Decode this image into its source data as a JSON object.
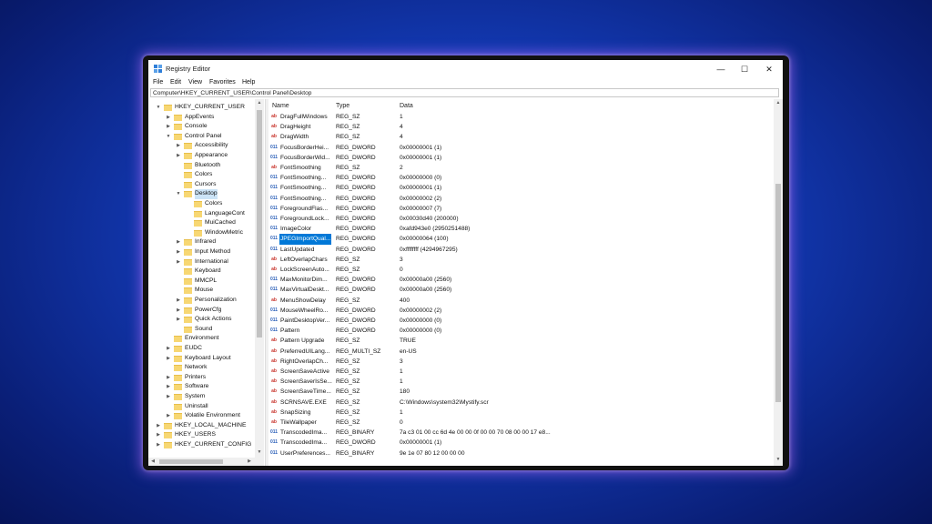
{
  "window": {
    "title": "Registry Editor",
    "controls": {
      "minimize": "—",
      "maximize": "☐",
      "close": "✕"
    }
  },
  "menu": [
    "File",
    "Edit",
    "View",
    "Favorites",
    "Help"
  ],
  "address": "Computer\\HKEY_CURRENT_USER\\Control Panel\\Desktop",
  "tree": [
    {
      "label": "HKEY_CURRENT_USER",
      "level": 0,
      "expander": "open"
    },
    {
      "label": "AppEvents",
      "level": 1,
      "expander": "closed"
    },
    {
      "label": "Console",
      "level": 1,
      "expander": "closed"
    },
    {
      "label": "Control Panel",
      "level": 1,
      "expander": "open"
    },
    {
      "label": "Accessibility",
      "level": 2,
      "expander": "closed"
    },
    {
      "label": "Appearance",
      "level": 2,
      "expander": "closed"
    },
    {
      "label": "Bluetooth",
      "level": 2,
      "expander": "none"
    },
    {
      "label": "Colors",
      "level": 2,
      "expander": "none"
    },
    {
      "label": "Cursors",
      "level": 2,
      "expander": "none"
    },
    {
      "label": "Desktop",
      "level": 2,
      "expander": "open",
      "selected": true
    },
    {
      "label": "Colors",
      "level": 3,
      "expander": "none"
    },
    {
      "label": "LanguageCont",
      "level": 3,
      "expander": "none"
    },
    {
      "label": "MuiCached",
      "level": 3,
      "expander": "none"
    },
    {
      "label": "WindowMetric",
      "level": 3,
      "expander": "none"
    },
    {
      "label": "Infrared",
      "level": 2,
      "expander": "closed"
    },
    {
      "label": "Input Method",
      "level": 2,
      "expander": "closed"
    },
    {
      "label": "International",
      "level": 2,
      "expander": "closed"
    },
    {
      "label": "Keyboard",
      "level": 2,
      "expander": "none"
    },
    {
      "label": "MMCPL",
      "level": 2,
      "expander": "none"
    },
    {
      "label": "Mouse",
      "level": 2,
      "expander": "none"
    },
    {
      "label": "Personalization",
      "level": 2,
      "expander": "closed"
    },
    {
      "label": "PowerCfg",
      "level": 2,
      "expander": "closed"
    },
    {
      "label": "Quick Actions",
      "level": 2,
      "expander": "closed"
    },
    {
      "label": "Sound",
      "level": 2,
      "expander": "none"
    },
    {
      "label": "Environment",
      "level": 1,
      "expander": "none"
    },
    {
      "label": "EUDC",
      "level": 1,
      "expander": "closed"
    },
    {
      "label": "Keyboard Layout",
      "level": 1,
      "expander": "closed"
    },
    {
      "label": "Network",
      "level": 1,
      "expander": "none"
    },
    {
      "label": "Printers",
      "level": 1,
      "expander": "closed"
    },
    {
      "label": "Software",
      "level": 1,
      "expander": "closed"
    },
    {
      "label": "System",
      "level": 1,
      "expander": "closed"
    },
    {
      "label": "Uninstall",
      "level": 1,
      "expander": "none"
    },
    {
      "label": "Volatile Environment",
      "level": 1,
      "expander": "closed"
    },
    {
      "label": "HKEY_LOCAL_MACHINE",
      "level": 0,
      "expander": "closed"
    },
    {
      "label": "HKEY_USERS",
      "level": 0,
      "expander": "closed"
    },
    {
      "label": "HKEY_CURRENT_CONFIG",
      "level": 0,
      "expander": "closed"
    }
  ],
  "columns": {
    "name": "Name",
    "type": "Type",
    "data": "Data"
  },
  "values": [
    {
      "icon": "ab",
      "name": "DragFullWindows",
      "type": "REG_SZ",
      "data": "1"
    },
    {
      "icon": "ab",
      "name": "DragHeight",
      "type": "REG_SZ",
      "data": "4"
    },
    {
      "icon": "ab",
      "name": "DragWidth",
      "type": "REG_SZ",
      "data": "4"
    },
    {
      "icon": "011",
      "name": "FocusBorderHei...",
      "type": "REG_DWORD",
      "data": "0x00000001 (1)"
    },
    {
      "icon": "011",
      "name": "FocusBorderWid...",
      "type": "REG_DWORD",
      "data": "0x00000001 (1)"
    },
    {
      "icon": "ab",
      "name": "FontSmoothing",
      "type": "REG_SZ",
      "data": "2"
    },
    {
      "icon": "011",
      "name": "FontSmoothing...",
      "type": "REG_DWORD",
      "data": "0x00000000 (0)"
    },
    {
      "icon": "011",
      "name": "FontSmoothing...",
      "type": "REG_DWORD",
      "data": "0x00000001 (1)"
    },
    {
      "icon": "011",
      "name": "FontSmoothing...",
      "type": "REG_DWORD",
      "data": "0x00000002 (2)"
    },
    {
      "icon": "011",
      "name": "ForegroundFlas...",
      "type": "REG_DWORD",
      "data": "0x00000007 (7)"
    },
    {
      "icon": "011",
      "name": "ForegroundLock...",
      "type": "REG_DWORD",
      "data": "0x00030d40 (200000)"
    },
    {
      "icon": "011",
      "name": "ImageColor",
      "type": "REG_DWORD",
      "data": "0xafd943e0 (2950251488)"
    },
    {
      "icon": "011",
      "name": "JPEGImportQual...",
      "type": "REG_DWORD",
      "data": "0x00000064 (100)",
      "selected": true
    },
    {
      "icon": "011",
      "name": "LastUpdated",
      "type": "REG_DWORD",
      "data": "0xffffffff (4294967295)"
    },
    {
      "icon": "ab",
      "name": "LeftOverlapChars",
      "type": "REG_SZ",
      "data": "3"
    },
    {
      "icon": "ab",
      "name": "LockScreenAuto...",
      "type": "REG_SZ",
      "data": "0"
    },
    {
      "icon": "011",
      "name": "MaxMonitorDim...",
      "type": "REG_DWORD",
      "data": "0x00000a00 (2560)"
    },
    {
      "icon": "011",
      "name": "MaxVirtualDeskt...",
      "type": "REG_DWORD",
      "data": "0x00000a00 (2560)"
    },
    {
      "icon": "ab",
      "name": "MenuShowDelay",
      "type": "REG_SZ",
      "data": "400"
    },
    {
      "icon": "011",
      "name": "MouseWheelRo...",
      "type": "REG_DWORD",
      "data": "0x00000002 (2)"
    },
    {
      "icon": "011",
      "name": "PaintDesktopVer...",
      "type": "REG_DWORD",
      "data": "0x00000000 (0)"
    },
    {
      "icon": "011",
      "name": "Pattern",
      "type": "REG_DWORD",
      "data": "0x00000000 (0)"
    },
    {
      "icon": "ab",
      "name": "Pattern Upgrade",
      "type": "REG_SZ",
      "data": "TRUE"
    },
    {
      "icon": "ab",
      "name": "PreferredUILang...",
      "type": "REG_MULTI_SZ",
      "data": "en-US"
    },
    {
      "icon": "ab",
      "name": "RightOverlapCh...",
      "type": "REG_SZ",
      "data": "3"
    },
    {
      "icon": "ab",
      "name": "ScreenSaveActive",
      "type": "REG_SZ",
      "data": "1"
    },
    {
      "icon": "ab",
      "name": "ScreenSaverIsSe...",
      "type": "REG_SZ",
      "data": "1"
    },
    {
      "icon": "ab",
      "name": "ScreenSaveTime...",
      "type": "REG_SZ",
      "data": "180"
    },
    {
      "icon": "ab",
      "name": "SCRNSAVE.EXE",
      "type": "REG_SZ",
      "data": "C:\\Windows\\system32\\Mystify.scr"
    },
    {
      "icon": "ab",
      "name": "SnapSizing",
      "type": "REG_SZ",
      "data": "1"
    },
    {
      "icon": "ab",
      "name": "TileWallpaper",
      "type": "REG_SZ",
      "data": "0"
    },
    {
      "icon": "011",
      "name": "TranscodedIma...",
      "type": "REG_BINARY",
      "data": "7a c3 01 00 cc 6d 4e 00 00 0f 00 00 70 08 00 00 17 e8..."
    },
    {
      "icon": "011",
      "name": "TranscodedIma...",
      "type": "REG_DWORD",
      "data": "0x00000001 (1)"
    },
    {
      "icon": "011",
      "name": "UserPreferences...",
      "type": "REG_BINARY",
      "data": "9e 1e 07 80 12 00 00 00"
    }
  ],
  "scroll_arrows": {
    "up": "▲",
    "down": "▼",
    "left": "◀",
    "right": "▶"
  }
}
